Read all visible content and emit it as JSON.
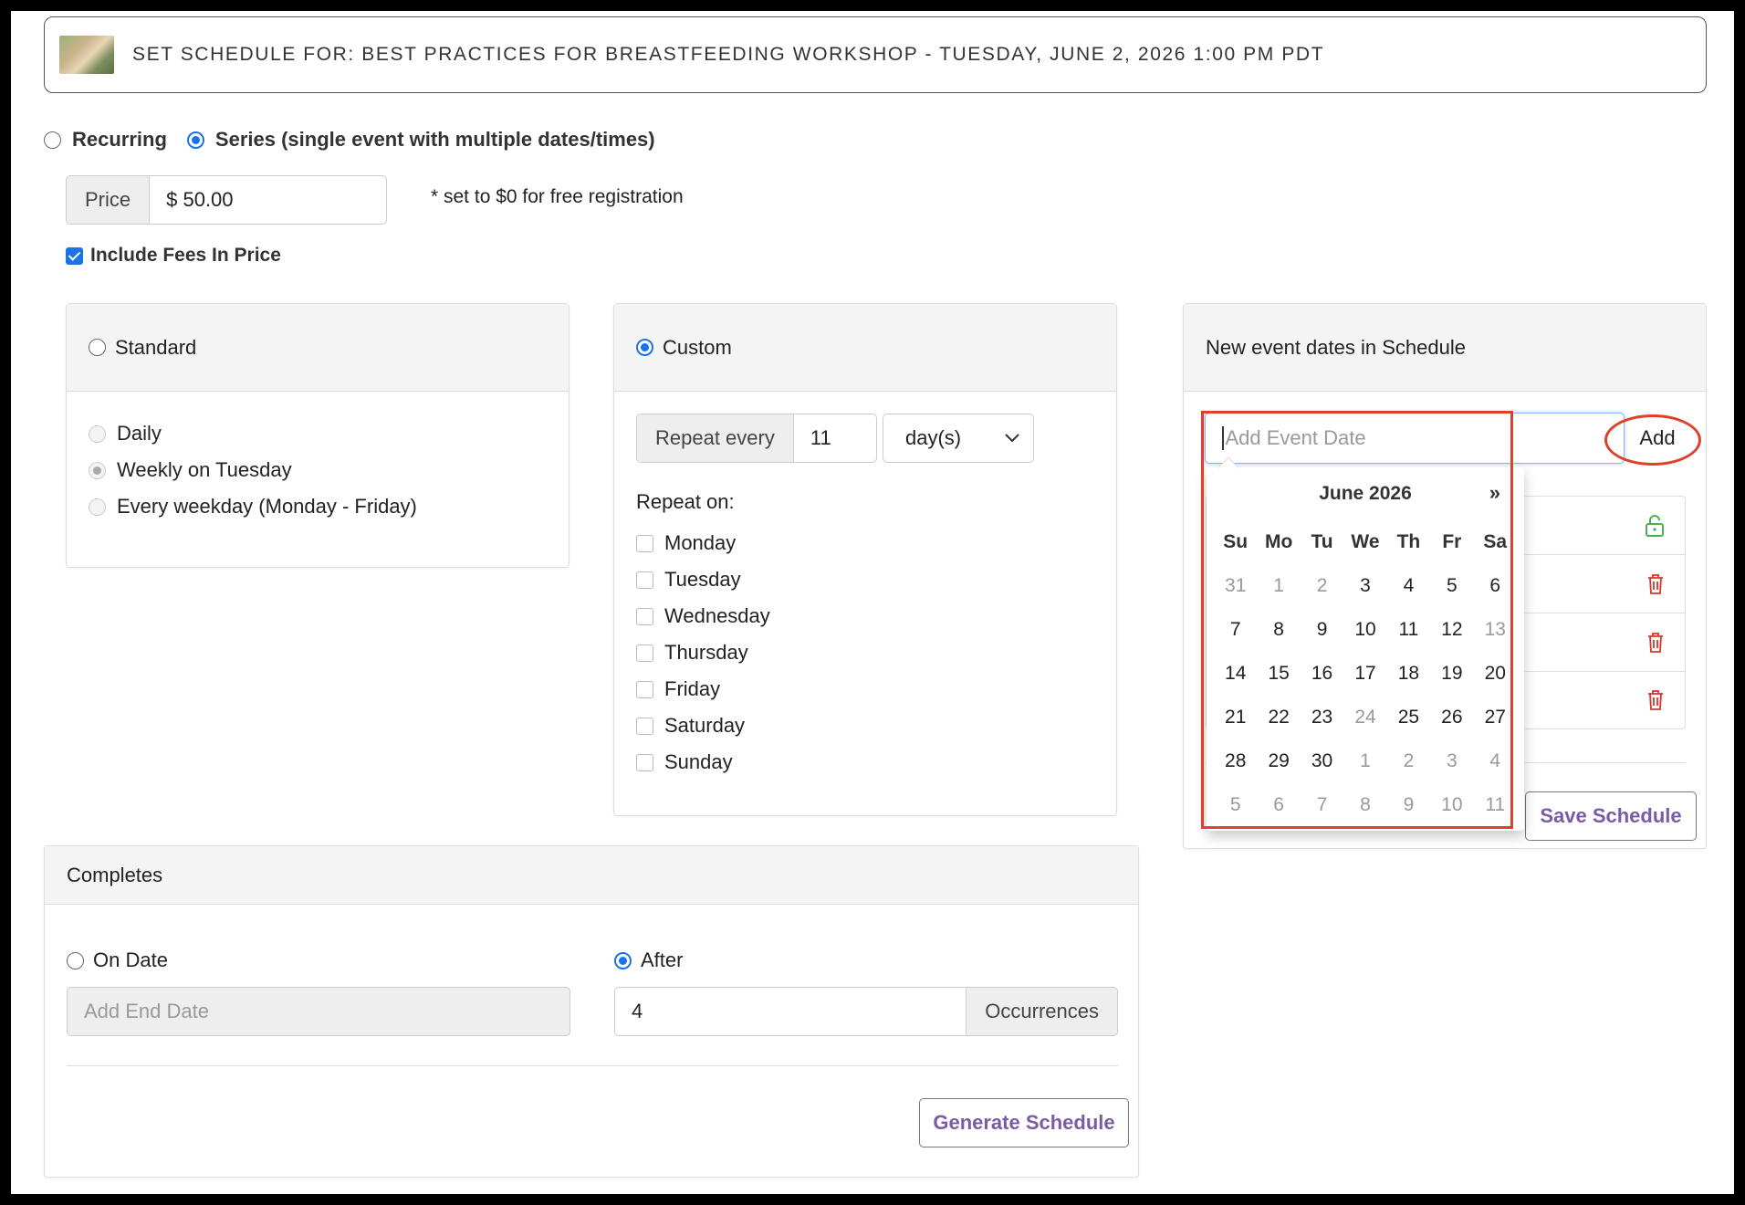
{
  "header": {
    "title": "SET SCHEDULE FOR: BEST PRACTICES FOR BREASTFEEDING WORKSHOP - TUESDAY, JUNE 2, 2026 1:00 PM PDT",
    "thumbnail_icon": "event-thumbnail-image"
  },
  "schedule_type": {
    "recurring_label": "Recurring",
    "series_label": "Series (single event with multiple dates/times)",
    "selected": "series"
  },
  "price": {
    "addon_label": "Price",
    "value": "$ 50.00",
    "hint": "* set to $0 for free registration"
  },
  "fees": {
    "label": "Include Fees In Price",
    "checked": true
  },
  "standard": {
    "title": "Standard",
    "options": [
      "Daily",
      "Weekly on Tuesday",
      "Every weekday (Monday - Friday)"
    ],
    "selected_option": "Weekly on Tuesday"
  },
  "custom": {
    "title": "Custom",
    "repeat_every_label": "Repeat every",
    "repeat_every_value": "11",
    "unit_value": "day(s)",
    "repeat_on_label": "Repeat on:",
    "days": [
      "Monday",
      "Tuesday",
      "Wednesday",
      "Thursday",
      "Friday",
      "Saturday",
      "Sunday"
    ]
  },
  "completes": {
    "title": "Completes",
    "on_date_label": "On Date",
    "end_date_placeholder": "Add End Date",
    "after_label": "After",
    "occurrences_value": "4",
    "occurrences_label": "Occurrences",
    "generate_button": "Generate Schedule",
    "selected": "after"
  },
  "new_dates": {
    "title": "New event dates in Schedule",
    "input_placeholder": "Add Event Date",
    "add_button": "Add",
    "save_button": "Save Schedule",
    "row_icons": [
      "unlock-icon",
      "trash-icon",
      "trash-icon",
      "trash-icon"
    ]
  },
  "datepicker": {
    "month_label": "June 2026",
    "next_label": "»",
    "weekdays": [
      "Su",
      "Mo",
      "Tu",
      "We",
      "Th",
      "Fr",
      "Sa"
    ],
    "weeks": [
      [
        "31",
        "1",
        "2",
        "3",
        "4",
        "5",
        "6"
      ],
      [
        "7",
        "8",
        "9",
        "10",
        "11",
        "12",
        "13"
      ],
      [
        "14",
        "15",
        "16",
        "17",
        "18",
        "19",
        "20"
      ],
      [
        "21",
        "22",
        "23",
        "24",
        "25",
        "26",
        "27"
      ],
      [
        "28",
        "29",
        "30",
        "1",
        "2",
        "3",
        "4"
      ],
      [
        "5",
        "6",
        "7",
        "8",
        "9",
        "10",
        "11"
      ]
    ],
    "muted": [
      [
        true,
        true,
        true,
        false,
        false,
        false,
        false
      ],
      [
        false,
        false,
        false,
        false,
        false,
        false,
        true
      ],
      [
        false,
        false,
        false,
        false,
        false,
        false,
        false
      ],
      [
        false,
        false,
        false,
        true,
        false,
        false,
        false
      ],
      [
        false,
        false,
        false,
        true,
        true,
        true,
        true
      ],
      [
        true,
        true,
        true,
        true,
        true,
        true,
        true
      ]
    ]
  },
  "annotations": {
    "highlight_color": "#e0402a"
  },
  "colors": {
    "accent": "#1a73e8",
    "button_text": "#7b5aa6",
    "unlock": "#4caf50",
    "trash": "#d9342b"
  }
}
